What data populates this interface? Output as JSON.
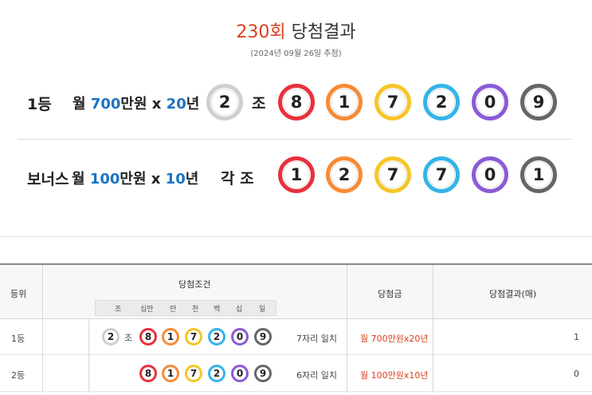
{
  "header": {
    "round": "230회",
    "title_suffix": " 당첨결과",
    "draw_date": "(2024년 09월 26일 추첨)"
  },
  "first_prize": {
    "rank": "1등",
    "desc_prefix": "월 ",
    "amount": "700",
    "desc_mid": "만원 x ",
    "years": "20",
    "desc_suffix": "년",
    "group": "2",
    "jo_label": "조",
    "numbers": [
      "8",
      "1",
      "7",
      "2",
      "0",
      "9"
    ]
  },
  "bonus_prize": {
    "rank": "보너스",
    "desc_prefix": "월 ",
    "amount": "100",
    "desc_mid": "만원 x ",
    "years": "10",
    "desc_suffix": "년",
    "jo_label": "각 조",
    "numbers": [
      "1",
      "2",
      "7",
      "7",
      "0",
      "1"
    ]
  },
  "colors": {
    "group_ball": "#cfcfcf",
    "digit_balls": [
      "#e8313d",
      "#f78b35",
      "#f7c528",
      "#35b4e8",
      "#8a5bd6",
      "#666666"
    ],
    "accent_red": "#d8401e",
    "accent_blue": "#1b74c4"
  },
  "table": {
    "headers": {
      "rank": "등위",
      "condition": "당첨조건",
      "prize": "당첨금",
      "result": "당첨결과(매)"
    },
    "sub_headers": [
      "조",
      "십만",
      "만",
      "천",
      "백",
      "십",
      "일"
    ],
    "rows": [
      {
        "rank": "1등",
        "group": "2",
        "jo": "조",
        "numbers": [
          "8",
          "1",
          "7",
          "2",
          "0",
          "9"
        ],
        "match": "7자리 일치",
        "prize": "월 700만원x20년",
        "count": "1"
      },
      {
        "rank": "2등",
        "numbers": [
          "8",
          "1",
          "7",
          "2",
          "0",
          "9"
        ],
        "match": "6자리 일치",
        "prize": "월 100만원x10년",
        "count": "0"
      }
    ]
  }
}
